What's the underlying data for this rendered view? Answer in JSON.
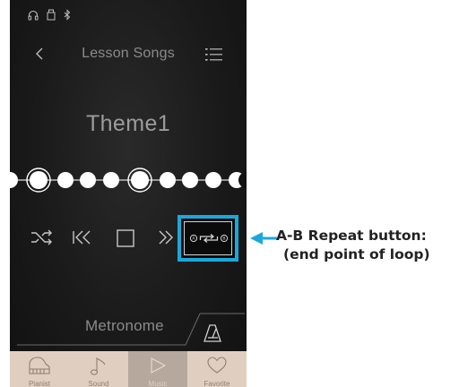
{
  "header": {
    "title": "Lesson Songs"
  },
  "song": {
    "title": "Theme1"
  },
  "metronome": {
    "label": "Metronome"
  },
  "tabs": [
    {
      "label": "Pianist",
      "icon": "piano-icon",
      "active": false
    },
    {
      "label": "Sound",
      "icon": "music-note-icon",
      "active": false
    },
    {
      "label": "Music",
      "icon": "play-icon",
      "active": true
    },
    {
      "label": "Favorite",
      "icon": "heart-icon",
      "active": false
    }
  ],
  "callout": {
    "line1": "A-B Repeat button:",
    "line2": "(end point of loop)"
  },
  "colors": {
    "highlight": "#1aa8dc",
    "tabbar": "#e0cfc0",
    "tab_active": "#b6a89c",
    "phone_bg": "#1a1a1a"
  }
}
